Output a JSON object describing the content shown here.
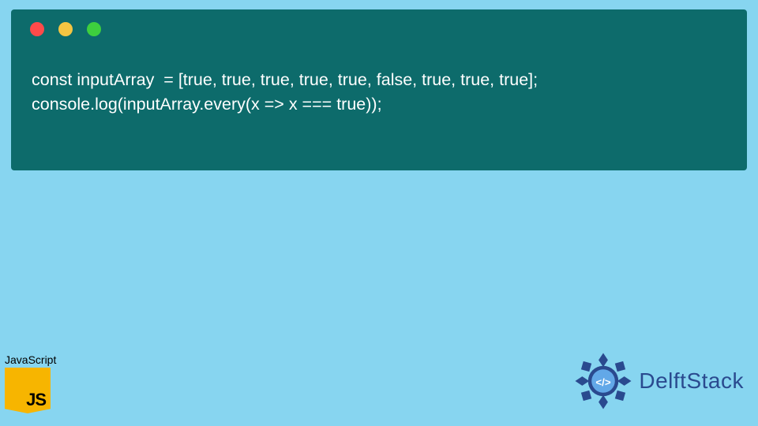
{
  "window": {
    "traffic_lights": [
      "red",
      "yellow",
      "green"
    ]
  },
  "code": {
    "line1": "const inputArray  = [true, true, true, true, true, false, true, true, true];",
    "line2": "console.log(inputArray.every(x => x === true));"
  },
  "js_badge": {
    "label": "JavaScript",
    "logo_text": "JS"
  },
  "brand": {
    "name": "DelftStack"
  }
}
